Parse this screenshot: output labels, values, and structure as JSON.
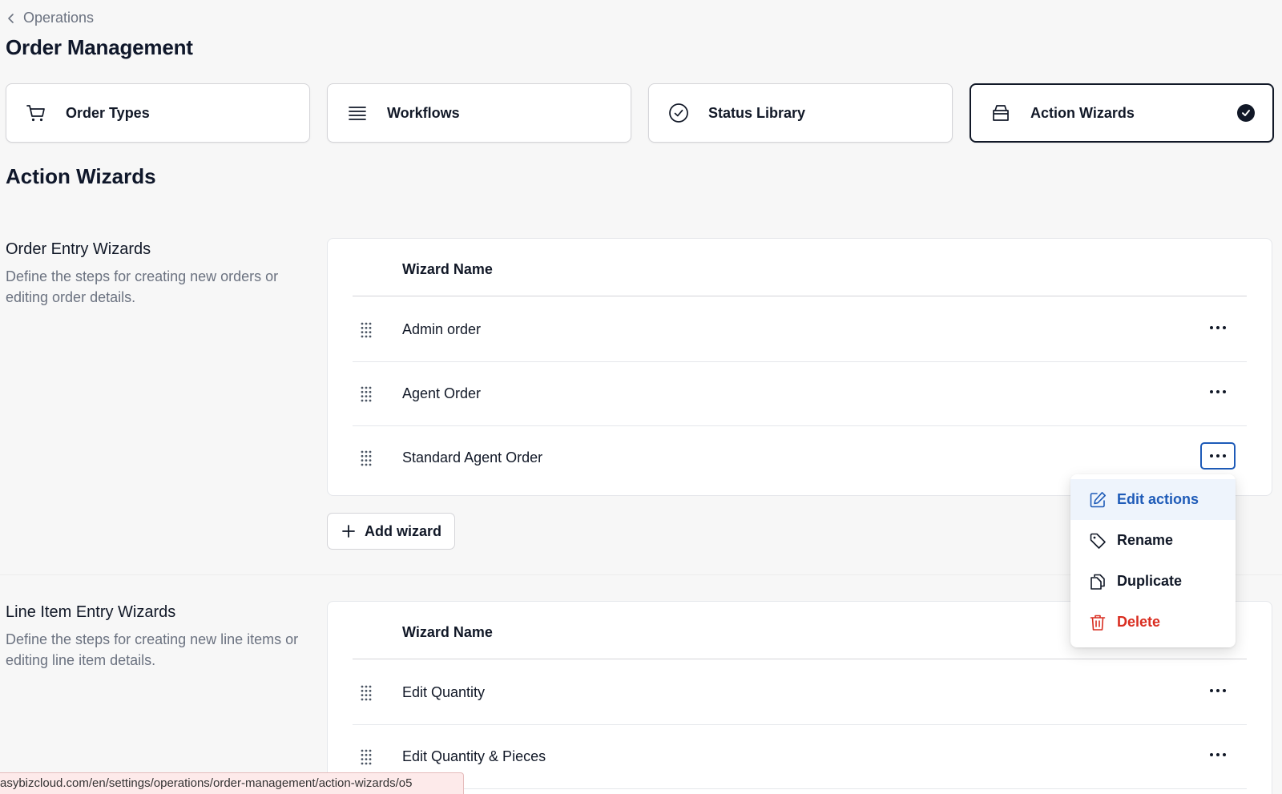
{
  "breadcrumb": {
    "label": "Operations"
  },
  "page_title": "Order Management",
  "nav_cards": [
    {
      "label": "Order Types",
      "icon": "cart-icon"
    },
    {
      "label": "Workflows",
      "icon": "stack-icon"
    },
    {
      "label": "Status Library",
      "icon": "circle-check-icon"
    },
    {
      "label": "Action Wizards",
      "icon": "box-icon",
      "active": true
    }
  ],
  "section_heading": "Action Wizards",
  "order_entry": {
    "title": "Order Entry Wizards",
    "description": "Define the steps for creating new orders or editing order details.",
    "column_header": "Wizard Name",
    "rows": [
      "Admin order",
      "Agent Order",
      "Standard Agent Order"
    ],
    "add_label": "Add wizard"
  },
  "line_item_entry": {
    "title": "Line Item Entry Wizards",
    "description": "Define the steps for creating new line items or editing line item details.",
    "column_header": "Wizard Name",
    "rows": [
      "Edit Quantity",
      "Edit Quantity & Pieces"
    ]
  },
  "menu": {
    "items": [
      "Edit actions",
      "Rename",
      "Duplicate",
      "Delete"
    ]
  },
  "status_url": "asybizcloud.com/en/settings/operations/order-management/action-wizards/o5",
  "colors": {
    "accent": "#1e5bb8",
    "danger": "#d92d20",
    "text": "#111827",
    "muted": "#6b7280"
  }
}
